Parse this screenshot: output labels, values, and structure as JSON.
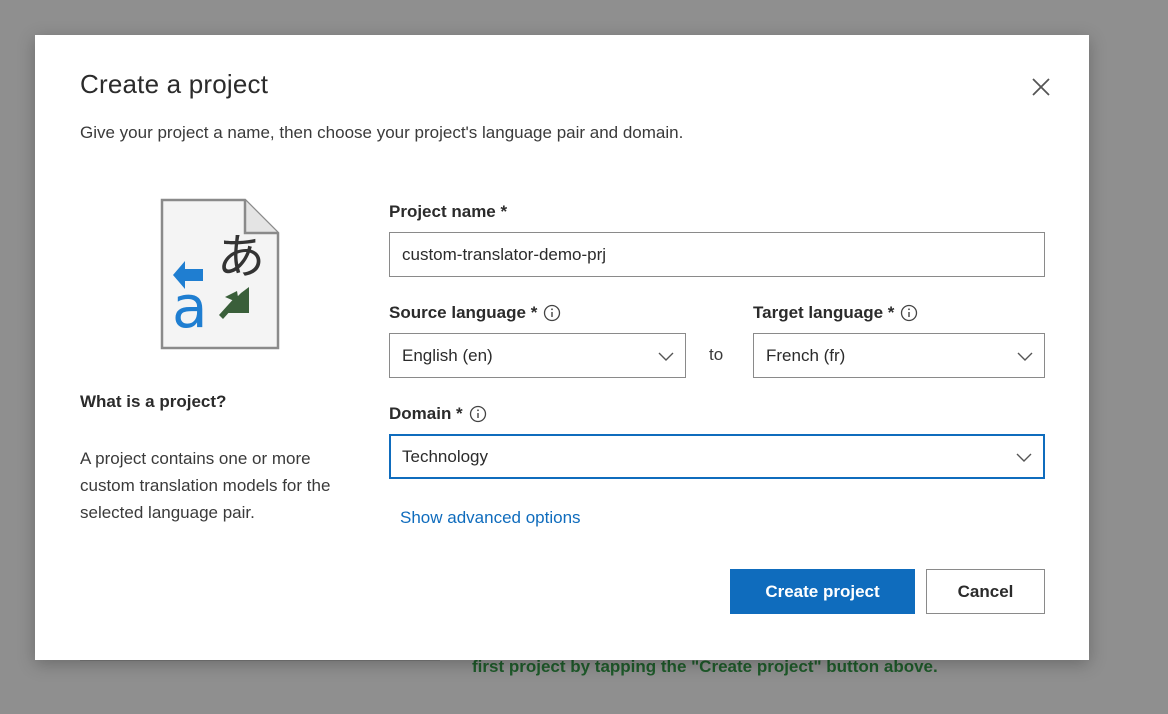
{
  "backdrop": {
    "hint_text": "first project by tapping the \"Create project\" button above."
  },
  "dialog": {
    "title": "Create a project",
    "subtitle": "Give your project a name, then choose your project's language pair and domain.",
    "what_title": "What is a project?",
    "what_body": "A project contains one or more custom translation models for the selected language pair."
  },
  "form": {
    "project_name_label": "Project name *",
    "project_name_value": "custom-translator-demo-prj",
    "source_language_label": "Source language *",
    "source_language_value": "English (en)",
    "to_label": "to",
    "target_language_label": "Target language *",
    "target_language_value": "French (fr)",
    "domain_label": "Domain *",
    "domain_value": "Technology",
    "advanced_link": "Show advanced options"
  },
  "buttons": {
    "create": "Create project",
    "cancel": "Cancel"
  },
  "colors": {
    "accent": "#0f6cbd",
    "illustration_blue": "#1f7ed1",
    "illustration_green": "#3a5f3a"
  }
}
